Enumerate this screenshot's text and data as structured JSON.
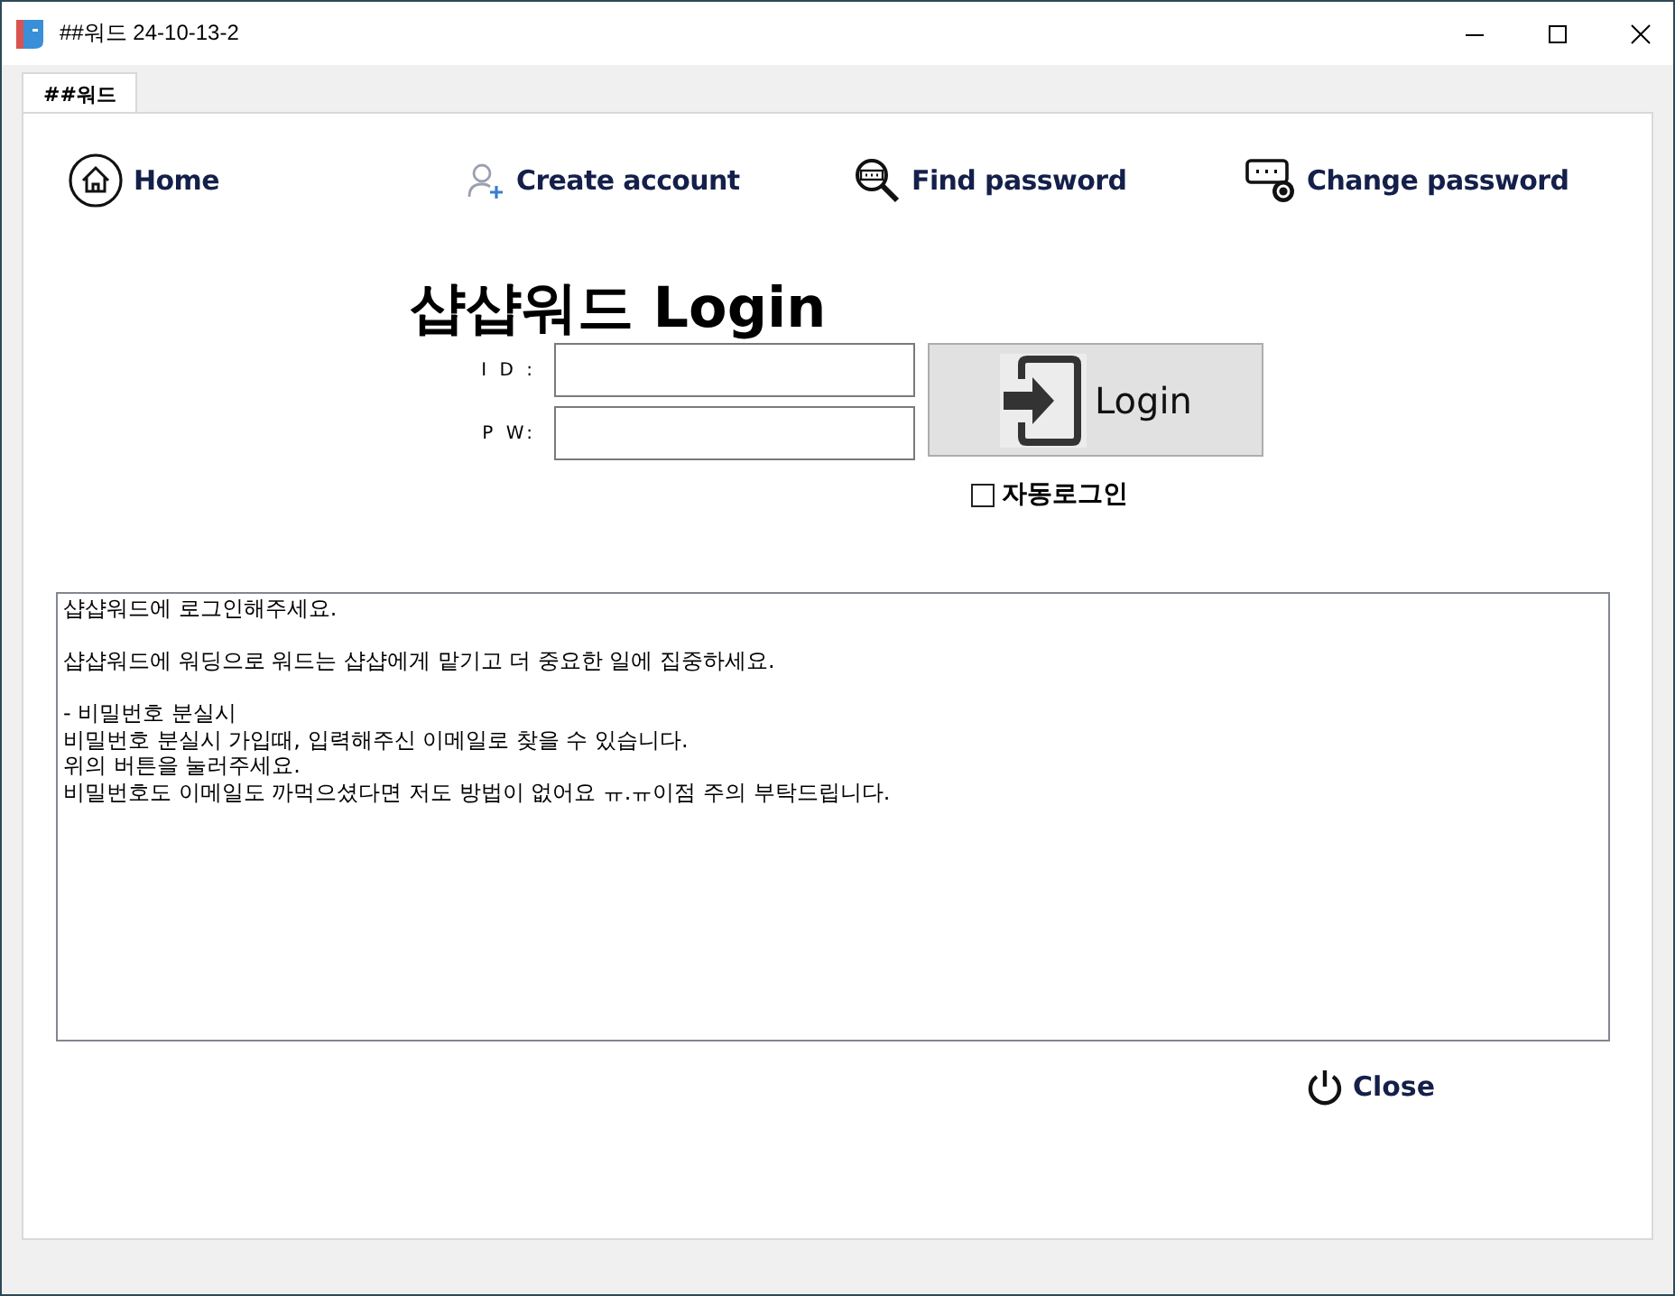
{
  "window": {
    "title": "##워드 24-10-13-2"
  },
  "tabs": [
    {
      "label": "##워드",
      "selected": true
    }
  ],
  "nav": [
    {
      "kind": "home",
      "label": "Home"
    },
    {
      "kind": "create",
      "label": "Create account"
    },
    {
      "kind": "find",
      "label": "Find password"
    },
    {
      "kind": "change",
      "label": "Change password"
    }
  ],
  "login": {
    "title": "샵샵워드 Login",
    "id_label": "I D :",
    "pw_label": "P W:",
    "button": "Login",
    "auto_login": {
      "label": "자동로그인",
      "checked": false
    }
  },
  "message": [
    [
      "샵샵워드에 로그인해주세요."
    ],
    [
      "샵샵워드에 워딩으로 워드는 샵샵에게 맡기고 더 중요한 일에 집중하세요."
    ],
    [
      "- 비밀번호 분실시",
      "비밀번호 분실시 가입때, 입력해주신 이메일로 찾을 수 있습니다.",
      "위의 버튼을 눌러주세요.",
      "비밀번호도 이메일도 까먹으셨다면 저도 방법이 없어요 ㅠ.ㅠ이점 주의 부탁드립니다."
    ]
  ],
  "close_button": "Close"
}
